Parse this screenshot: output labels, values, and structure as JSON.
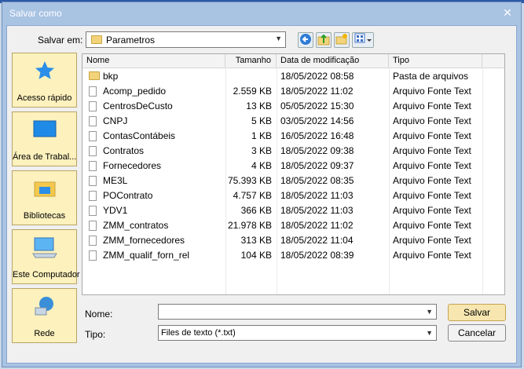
{
  "window": {
    "title": "Salvar como",
    "close_glyph": "✕"
  },
  "toolbar": {
    "save_in_label": "Salvar em:",
    "folder": "Parametros",
    "buttons": [
      "back-icon",
      "up-folder-icon",
      "new-folder-icon",
      "view-menu-icon"
    ]
  },
  "places": [
    {
      "label": "Acesso rápido",
      "icon": "star-icon"
    },
    {
      "label": "Área de Trabal...",
      "icon": "desktop-icon"
    },
    {
      "label": "Bibliotecas",
      "icon": "library-icon"
    },
    {
      "label": "Este Computador",
      "icon": "computer-icon"
    },
    {
      "label": "Rede",
      "icon": "network-icon"
    }
  ],
  "columns": {
    "name": "Nome",
    "size": "Tamanho",
    "date": "Data de modificação",
    "type": "Tipo"
  },
  "files": [
    {
      "name": "bkp",
      "size": "",
      "date": "18/05/2022 08:58",
      "type": "Pasta de arquivos",
      "kind": "folder"
    },
    {
      "name": "Acomp_pedido",
      "size": "2.559 KB",
      "date": "18/05/2022 11:02",
      "type": "Arquivo Fonte Text",
      "kind": "file"
    },
    {
      "name": "CentrosDeCusto",
      "size": "13 KB",
      "date": "05/05/2022 15:30",
      "type": "Arquivo Fonte Text",
      "kind": "file"
    },
    {
      "name": "CNPJ",
      "size": "5 KB",
      "date": "03/05/2022 14:56",
      "type": "Arquivo Fonte Text",
      "kind": "file"
    },
    {
      "name": "ContasContábeis",
      "size": "1 KB",
      "date": "16/05/2022 16:48",
      "type": "Arquivo Fonte Text",
      "kind": "file"
    },
    {
      "name": "Contratos",
      "size": "3 KB",
      "date": "18/05/2022 09:38",
      "type": "Arquivo Fonte Text",
      "kind": "file"
    },
    {
      "name": "Fornecedores",
      "size": "4 KB",
      "date": "18/05/2022 09:37",
      "type": "Arquivo Fonte Text",
      "kind": "file"
    },
    {
      "name": "ME3L",
      "size": "75.393 KB",
      "date": "18/05/2022 08:35",
      "type": "Arquivo Fonte Text",
      "kind": "file"
    },
    {
      "name": "POContrato",
      "size": "4.757 KB",
      "date": "18/05/2022 11:03",
      "type": "Arquivo Fonte Text",
      "kind": "file"
    },
    {
      "name": "YDV1",
      "size": "366 KB",
      "date": "18/05/2022 11:03",
      "type": "Arquivo Fonte Text",
      "kind": "file"
    },
    {
      "name": "ZMM_contratos",
      "size": "21.978 KB",
      "date": "18/05/2022 11:02",
      "type": "Arquivo Fonte Text",
      "kind": "file"
    },
    {
      "name": "ZMM_fornecedores",
      "size": "313 KB",
      "date": "18/05/2022 11:04",
      "type": "Arquivo Fonte Text",
      "kind": "file"
    },
    {
      "name": "ZMM_qualif_forn_rel",
      "size": "104 KB",
      "date": "18/05/2022 08:39",
      "type": "Arquivo Fonte Text",
      "kind": "file"
    }
  ],
  "form": {
    "name_label": "Nome:",
    "name_value": "",
    "type_label": "Tipo:",
    "type_value": "Files de texto (*.txt)"
  },
  "actions": {
    "save": "Salvar",
    "cancel": "Cancelar"
  },
  "colors": {
    "accent": "#2d5aa8",
    "place_bg": "#fdf1bd",
    "primary_btn": "#f7e6b0"
  }
}
